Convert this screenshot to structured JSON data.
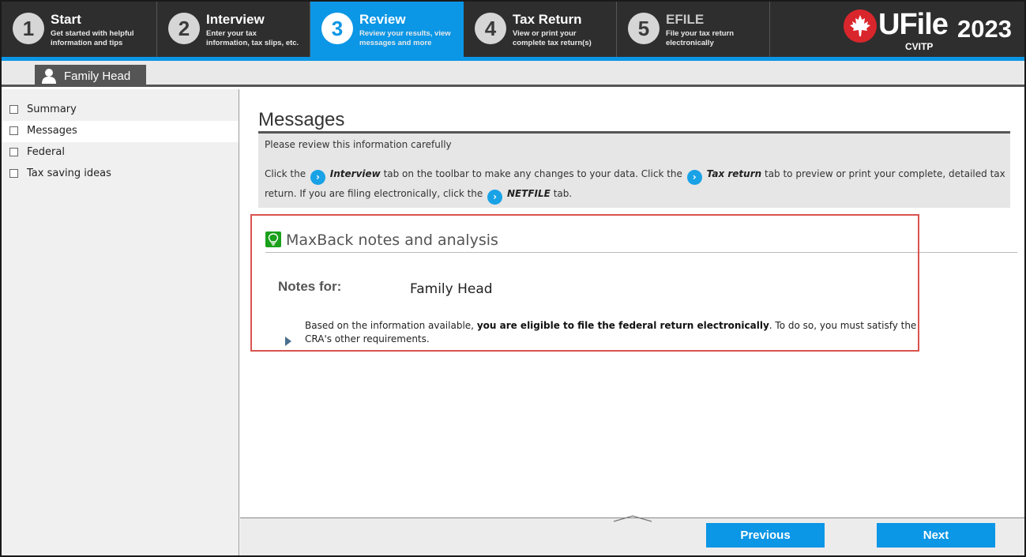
{
  "steps": [
    {
      "num": "1",
      "title": "Start",
      "desc1": "Get started with helpful",
      "desc2": "information and tips"
    },
    {
      "num": "2",
      "title": "Interview",
      "desc1": "Enter your tax",
      "desc2": "information, tax slips, etc."
    },
    {
      "num": "3",
      "title": "Review",
      "desc1": "Review your results, view",
      "desc2": "messages and more"
    },
    {
      "num": "4",
      "title": "Tax Return",
      "desc1": "View or print your",
      "desc2": "complete tax return(s)"
    },
    {
      "num": "5",
      "title": "EFILE",
      "desc1": "File your tax return",
      "desc2": "electronically"
    }
  ],
  "brand": {
    "name": "UFile",
    "year": "2023",
    "sub": "CVITP"
  },
  "person_tab": "Family Head",
  "sidebar": {
    "items": [
      {
        "label": "Summary"
      },
      {
        "label": "Messages"
      },
      {
        "label": "Federal"
      },
      {
        "label": "Tax saving ideas"
      }
    ]
  },
  "main": {
    "title": "Messages",
    "info_line": "Please review this information carefully",
    "para": {
      "t1": "Click the",
      "interview": "Interview",
      "t2": "tab on the toolbar to make any changes to your data. Click the",
      "taxreturn": "Tax return",
      "t3": "tab to preview or print your complete, detailed tax return. If you are filing electronically, click the",
      "netfile": "NETFILE",
      "t4": "tab."
    },
    "maxback_title": "MaxBack notes and analysis",
    "notes_label": "Notes for:",
    "notes_name": "Family Head",
    "note": {
      "pre": "Based on the information available,",
      "bold": "you are eligible to file the federal return electronically",
      "post": ". To do so, you must satisfy the CRA's other requirements."
    }
  },
  "footer": {
    "previous": "Previous",
    "next": "Next"
  },
  "colors": {
    "accent": "#0b96e6",
    "topbar": "#2e2e2e",
    "highlight": "#d9534f"
  }
}
